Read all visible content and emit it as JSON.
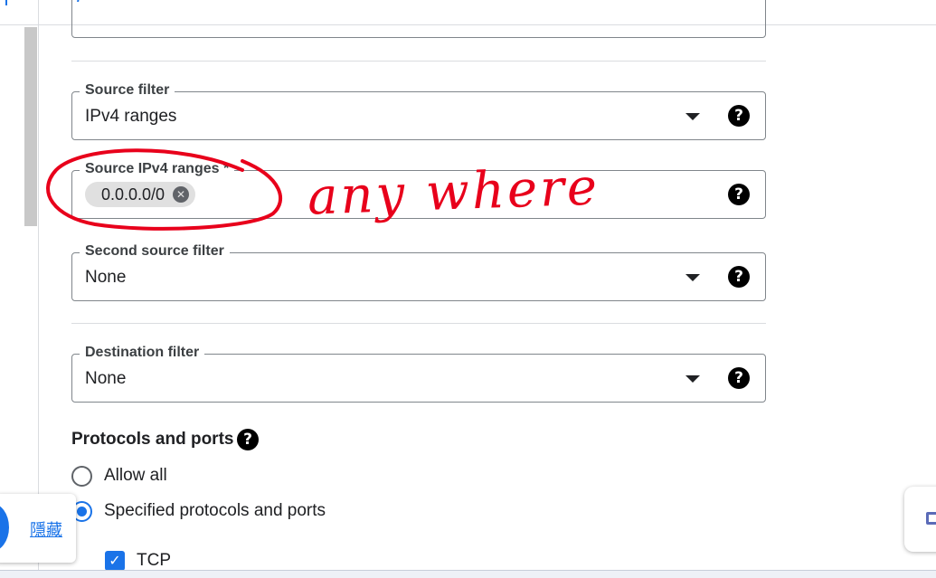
{
  "form": {
    "source_filter": {
      "label": "Source filter",
      "value": "IPv4 ranges",
      "help": "?"
    },
    "source_ranges": {
      "label": "Source IPv4 ranges *",
      "chip": "0.0.0.0/0",
      "remove": "✕",
      "help": "?"
    },
    "second_source_filter": {
      "label": "Second source filter",
      "value": "None",
      "help": "?"
    },
    "destination_filter": {
      "label": "Destination filter",
      "value": "None",
      "help": "?"
    }
  },
  "protocols": {
    "title": "Protocols and ports",
    "help": "?",
    "options": [
      {
        "label": "Allow all",
        "checked": false
      },
      {
        "label": "Specified protocols and ports",
        "checked": true
      }
    ],
    "tcp": {
      "label": "TCP",
      "checked": true,
      "mark": "✓"
    }
  },
  "annotation": {
    "text": "any where",
    "color": "#e8001b"
  },
  "overlay": {
    "hide_label": "隱藏"
  },
  "colors": {
    "accent": "#1a73e8",
    "border": "#80868b",
    "divider": "#dadce0"
  },
  "icons": [
    "help-icon",
    "dropdown-arrow-icon",
    "chip-remove-icon",
    "checkbox-check-icon"
  ]
}
